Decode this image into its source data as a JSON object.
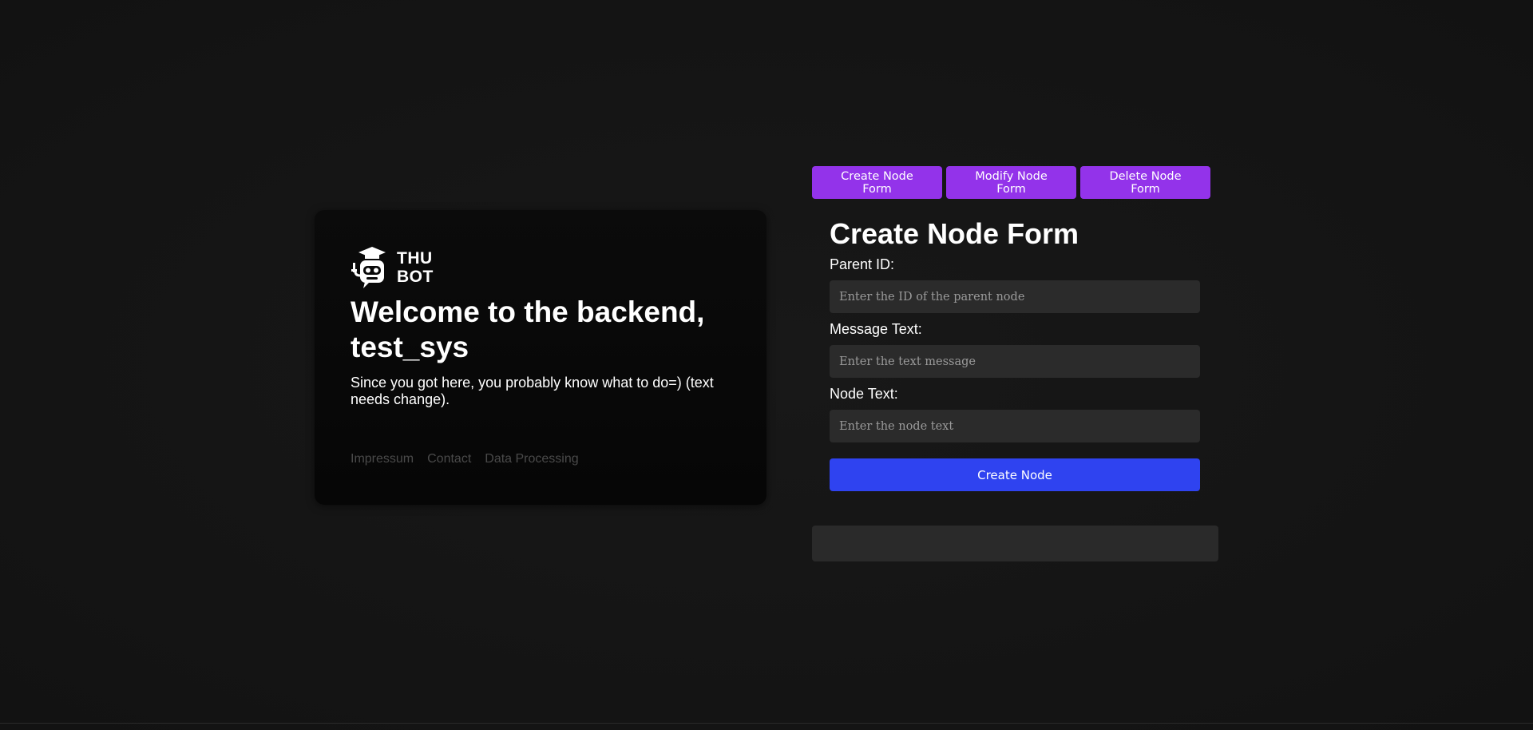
{
  "welcome": {
    "logo_alt": "THU BOT",
    "logo_line1": "THU",
    "logo_line2": "BOT",
    "title": "Welcome to the backend, test_sys",
    "subtitle": "Since you got here, you probably know what to do=) (text needs change).",
    "footer_links": [
      "Impressum",
      "Contact",
      "Data Processing"
    ]
  },
  "tabs": {
    "create": "Create Node Form",
    "modify": "Modify Node Form",
    "delete": "Delete Node Form"
  },
  "form": {
    "title": "Create Node Form",
    "parent_id_label": "Parent ID:",
    "parent_id_placeholder": "Enter the ID of the parent node",
    "parent_id_value": "",
    "message_label": "Message Text:",
    "message_placeholder": "Enter the text message",
    "message_value": "",
    "node_text_label": "Node Text:",
    "node_text_placeholder": "Enter the node text",
    "node_text_value": "",
    "submit_label": "Create Node"
  },
  "colors": {
    "background": "#161616",
    "card": "#0a0a0a",
    "tab_button": "#9333ea",
    "submit_button": "#2f43f0",
    "input_bg": "#2b2b2b",
    "footer_link": "#4a4a4a"
  }
}
